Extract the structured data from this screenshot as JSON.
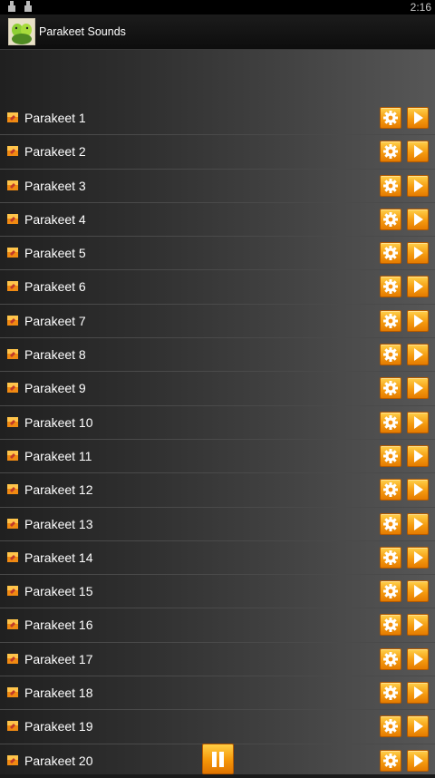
{
  "status_bar": {
    "time": "2:16",
    "notification_icons": [
      "notification-icon",
      "notification-icon"
    ]
  },
  "action_bar": {
    "title": "Parakeet Sounds",
    "icon": "parakeet-app-icon"
  },
  "sounds": [
    {
      "label": "Parakeet 1"
    },
    {
      "label": "Parakeet 2"
    },
    {
      "label": "Parakeet 3"
    },
    {
      "label": "Parakeet 4"
    },
    {
      "label": "Parakeet 5"
    },
    {
      "label": "Parakeet 6"
    },
    {
      "label": "Parakeet 7"
    },
    {
      "label": "Parakeet 8"
    },
    {
      "label": "Parakeet 9"
    },
    {
      "label": "Parakeet 10"
    },
    {
      "label": "Parakeet 11"
    },
    {
      "label": "Parakeet 12"
    },
    {
      "label": "Parakeet 13"
    },
    {
      "label": "Parakeet 14"
    },
    {
      "label": "Parakeet 15"
    },
    {
      "label": "Parakeet 16"
    },
    {
      "label": "Parakeet 17"
    },
    {
      "label": "Parakeet 18"
    },
    {
      "label": "Parakeet 19"
    },
    {
      "label": "Parakeet 20"
    }
  ],
  "row_icons": {
    "bullet": "sound-bullet-icon",
    "settings": "gear-icon",
    "play": "play-icon"
  },
  "pause_button": {
    "icon": "pause-icon"
  },
  "colors": {
    "accent_orange": "#f59b10",
    "text": "#ffffff"
  }
}
